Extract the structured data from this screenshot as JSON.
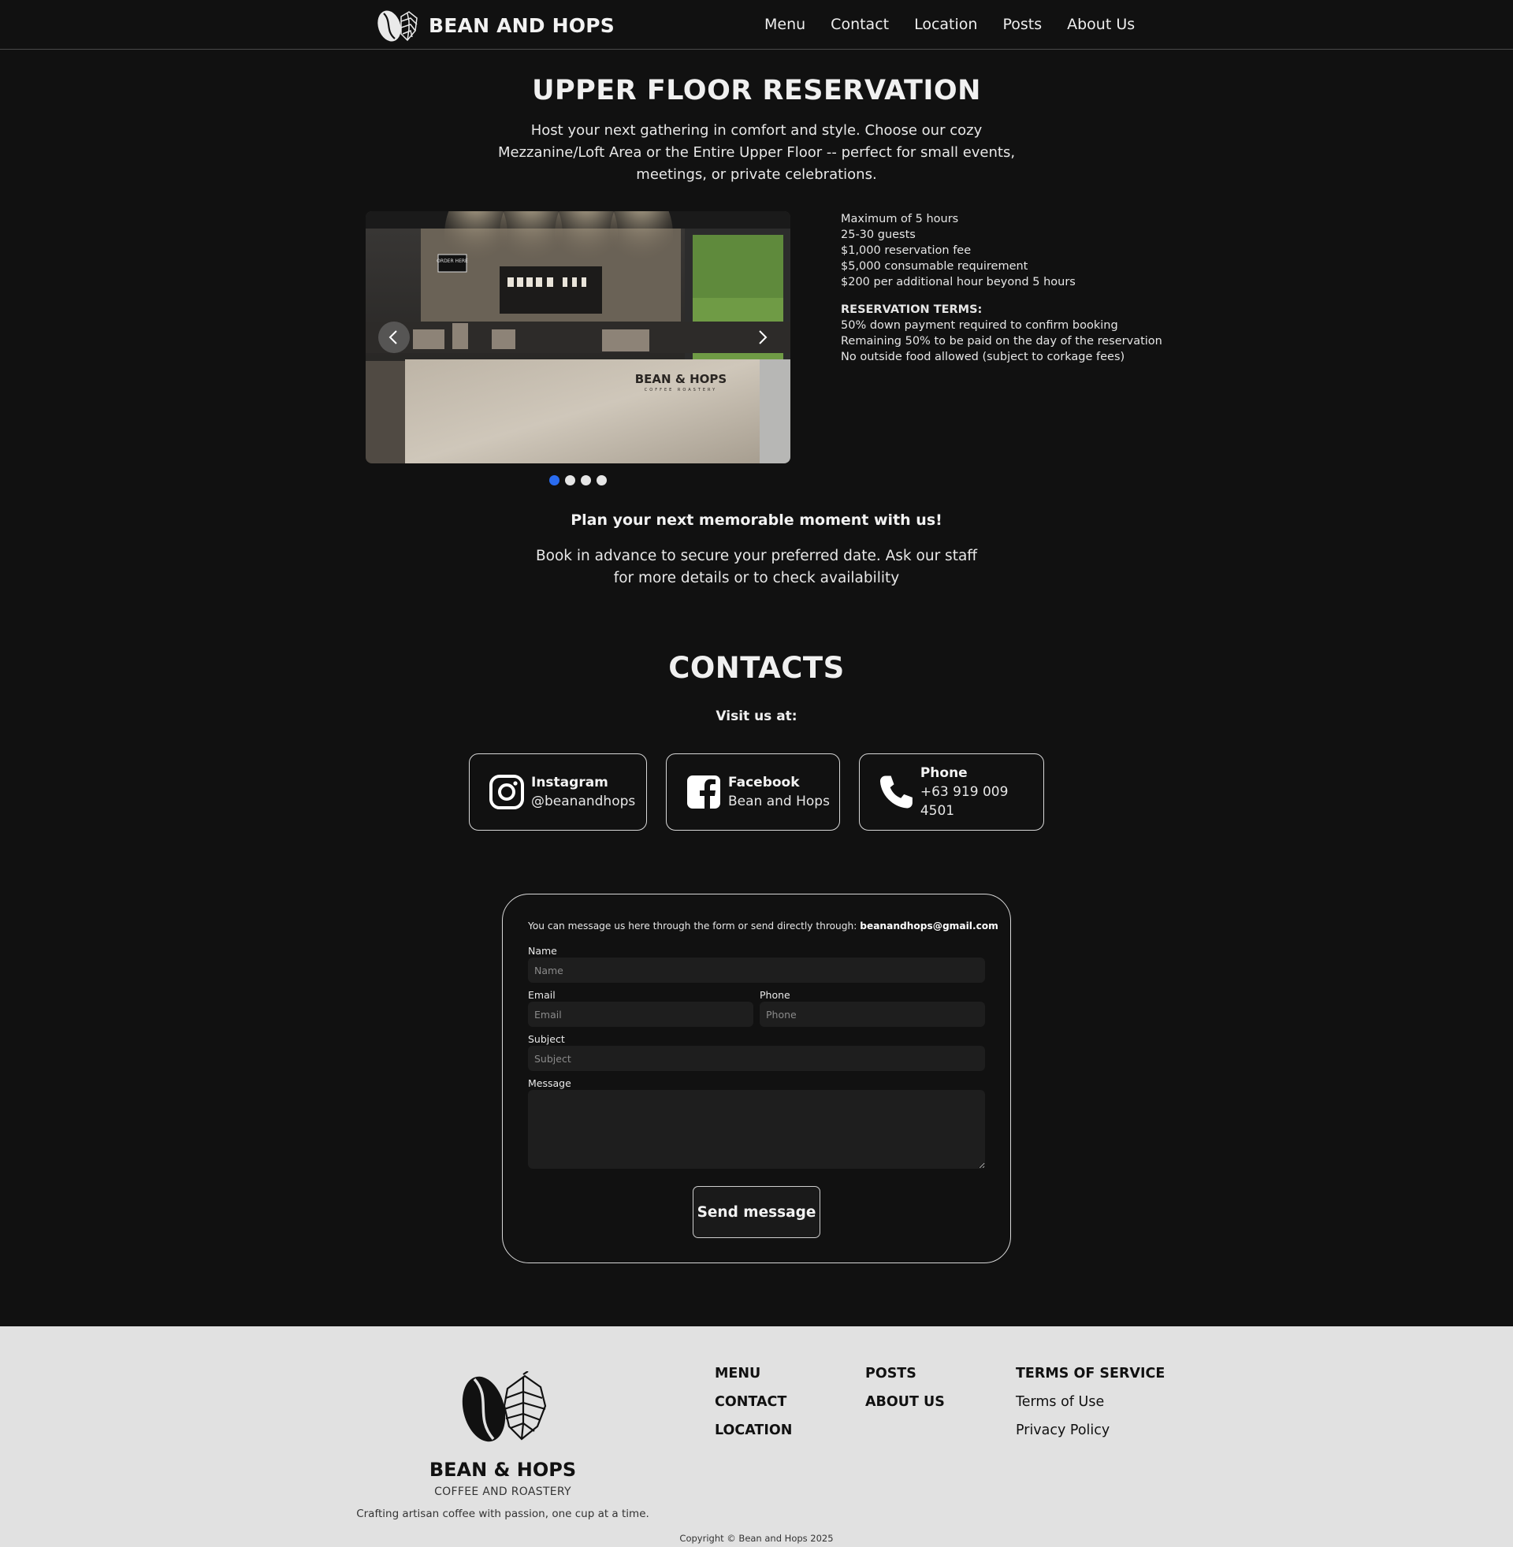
{
  "nav": {
    "brand": "BEAN AND HOPS",
    "links": [
      "Menu",
      "Contact",
      "Location",
      "Posts",
      "About Us"
    ]
  },
  "reservation": {
    "title": "UPPER FLOOR RESERVATION",
    "intro": "Host your next gathering in comfort and style. Choose our cozy Mezzanine/Loft Area or the Entire Upper Floor -- perfect for small events, meetings, or private celebrations.",
    "carousel": {
      "prev_icon": "chevron-left-icon",
      "next_icon": "chevron-right-icon",
      "slide_count": 4,
      "active_slide": 1,
      "active_color": "#2a6cf0",
      "image_signage": "BEAN & HOPS",
      "image_signage_sub": "COFFEE ROASTERY",
      "image_sign": "ORDER HERE"
    },
    "details": [
      "Maximum of 5 hours",
      "25-30 guests",
      "$1,000 reservation fee",
      "$5,000 consumable requirement",
      "$200 per additional hour beyond 5 hours"
    ],
    "terms_heading": "RESERVATION TERMS:",
    "terms": [
      "50% down payment required to confirm booking",
      "Remaining 50% to be paid on the day of the reservation",
      "No outside food allowed (subject to corkage fees)"
    ],
    "plan_heading": "Plan your next memorable moment with us!",
    "plan_text": "Book in advance to secure your preferred date. Ask our staff for more details or to check availability"
  },
  "contacts": {
    "title": "CONTACTS",
    "visit": "Visit us at:",
    "cards": [
      {
        "title": "Instagram",
        "value": "@beanandhops",
        "icon": "instagram-icon"
      },
      {
        "title": "Facebook",
        "value": "Bean and Hops",
        "icon": "facebook-icon"
      },
      {
        "title": "Phone",
        "value": "+63 919 009 4501",
        "icon": "phone-icon"
      }
    ]
  },
  "form": {
    "note": "You can message us here through the form or send directly through:",
    "email": "beanandhops@gmail.com",
    "name_label": "Name",
    "name_placeholder": "Name",
    "email_label": "Email",
    "email_placeholder": "Email",
    "phone_label": "Phone",
    "phone_placeholder": "Phone",
    "subject_label": "Subject",
    "subject_placeholder": "Subject",
    "message_label": "Message",
    "send_label": "Send message"
  },
  "footer": {
    "brand": "BEAN & HOPS",
    "sub": "COFFEE AND ROASTERY",
    "tagline": "Crafting artisan coffee with passion, one cup at a time.",
    "col1": [
      "MENU",
      "CONTACT",
      "LOCATION"
    ],
    "col2": [
      "POSTS",
      "ABOUT US"
    ],
    "col3_heading": "TERMS OF SERVICE",
    "col3": [
      "Terms of Use",
      "Privacy Policy"
    ],
    "copyright": "Copyright © Bean and Hops 2025"
  }
}
